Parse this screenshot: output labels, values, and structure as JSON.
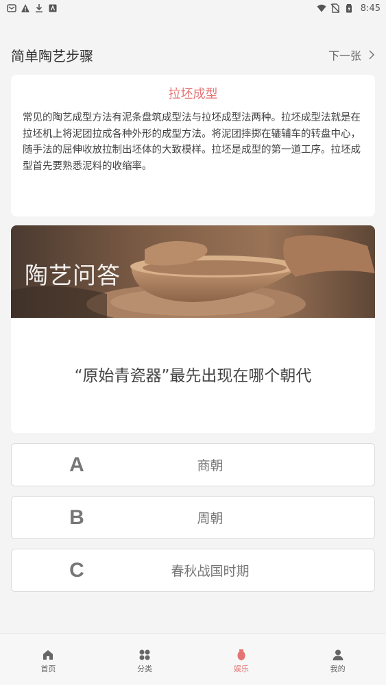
{
  "status_bar": {
    "time": "8:45",
    "left_icons": [
      "notification-icon",
      "warning-icon",
      "download-icon",
      "app-icon"
    ],
    "right_icons": [
      "wifi-icon",
      "no-sim-icon",
      "battery-icon"
    ]
  },
  "header": {
    "title": "简单陶艺步骤",
    "next_label": "下一张"
  },
  "step_card": {
    "title": "拉坯成型",
    "description": "常见的陶艺成型方法有泥条盘筑成型法与拉坯成型法两种。拉坯成型法就是在拉坯机上将泥团拉成各种外形的成型方法。将泥团摔掷在辘辅车的转盘中心，随手法的屈伸收放拉制出坯体的大致模样。拉坯是成型的第一道工序。拉坯成型首先要熟悉泥料的收缩率。"
  },
  "quiz": {
    "banner_label": "陶艺问答",
    "question": "“原始青瓷器”最先出现在哪个朝代",
    "options": [
      {
        "letter": "A",
        "text": "商朝"
      },
      {
        "letter": "B",
        "text": "周朝"
      },
      {
        "letter": "C",
        "text": "春秋战国时期"
      }
    ]
  },
  "bottom_nav": {
    "items": [
      {
        "label": "首页",
        "icon": "home-icon"
      },
      {
        "label": "分类",
        "icon": "category-icon"
      },
      {
        "label": "娱乐",
        "icon": "vase-icon",
        "active": true
      },
      {
        "label": "我的",
        "icon": "user-icon"
      }
    ]
  },
  "colors": {
    "accent": "#e57373",
    "background": "#f4f4f4"
  }
}
